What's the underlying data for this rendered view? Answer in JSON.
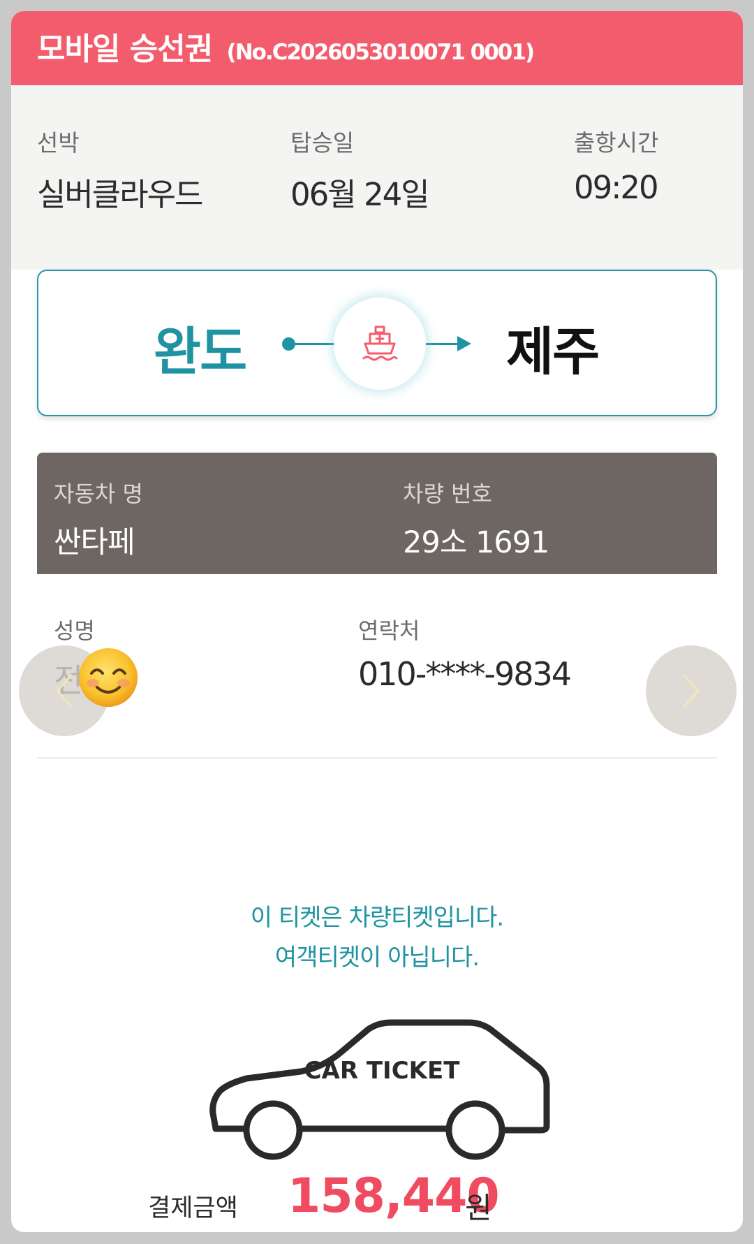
{
  "header": {
    "title": "모바일 승선권",
    "ticket_no": "(No.C2026053010071 0001)"
  },
  "info": {
    "ship_label": "선박",
    "ship_value": "실버클라우드",
    "date_label": "탑승일",
    "date_value": "06월 24일",
    "time_label": "출항시간",
    "time_value": "09:20"
  },
  "route": {
    "from": "완도",
    "to": "제주",
    "ship_icon": "ship-icon"
  },
  "vehicle": {
    "name_label": "자동차 명",
    "name_value": "싼타페",
    "plate_label": "차량 번호",
    "plate_value": "29소 1691"
  },
  "passenger": {
    "name_label": "성명",
    "name_value": "전",
    "contact_label": "연락처",
    "contact_value": "010-****-9834",
    "redaction": "smiling-face-emoji"
  },
  "notice": {
    "line1": "이 티켓은 차량티켓입니다.",
    "line2": "여객티켓이 아닙니다."
  },
  "car_ticket": {
    "label": "CAR TICKET"
  },
  "payment": {
    "label": "결제금액",
    "amount": "158,440",
    "unit": "원"
  },
  "colors": {
    "header": "#f35c6c",
    "accent_teal": "#1f93a2",
    "vehicle_bar": "#6d6662",
    "amount": "#ef4b61"
  }
}
